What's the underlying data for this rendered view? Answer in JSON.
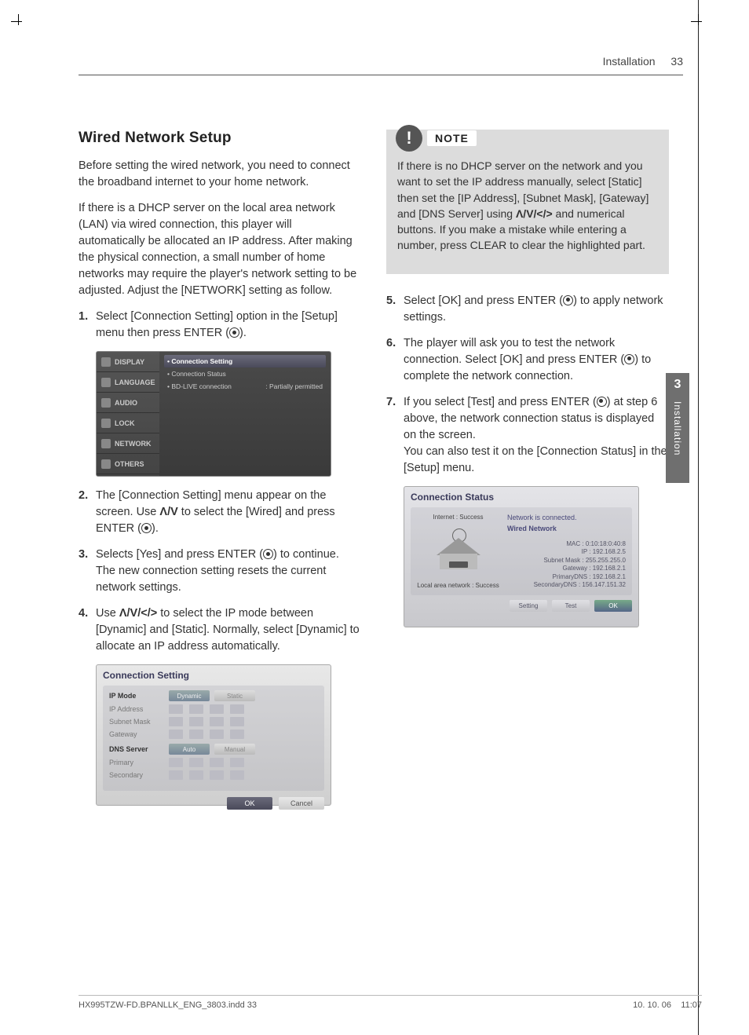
{
  "header": {
    "section": "Installation",
    "page": "33"
  },
  "title": "Wired Network Setup",
  "para1": "Before setting the wired network, you need to connect the broadband internet to your home network.",
  "para2": "If there is a DHCP server on the local area network (LAN) via wired connection, this player will automatically be allocated an IP address. After making the physical connection, a small number of home networks may require the player's network setting to be adjusted. Adjust the [NETWORK] setting as follow.",
  "steps": {
    "s1": "Select [Connection Setting] option in the [Setup] menu then press ENTER (",
    "s1b": ").",
    "s2a": "The [Connection Setting] menu appear on the screen. Use ",
    "s2b": " to select the [Wired] and press ENTER (",
    "s2c": ").",
    "s3a": "Selects [Yes] and press ENTER (",
    "s3b": ") to continue. The new connection setting resets the current network settings.",
    "s4a": "Use ",
    "s4b": " to select the IP mode between [Dynamic] and [Static]. Normally, select [Dynamic] to allocate an IP address automatically.",
    "s5a": "Select [OK] and press ENTER (",
    "s5b": ") to apply network settings.",
    "s6a": "The player will ask you to test the network connection. Select [OK] and press ENTER (",
    "s6b": ") to complete the network connection.",
    "s7a": "If you select [Test] and press ENTER (",
    "s7b": ") at step 6 above, the network connection status is displayed on the screen.",
    "s7c": "You can also test it on the [Connection Status] in the [Setup] menu."
  },
  "arrows_ud": "Λ/V",
  "arrows_all": "Λ/V/</>",
  "note": {
    "title": "NOTE",
    "body_a": "If there is no DHCP server on the network and you want to set the IP address manually, select [Static] then set the [IP Address], [Subnet Mask], [Gateway] and [DNS Server] using ",
    "body_b": " and numerical buttons. If you make a mistake while entering a number, press CLEAR to clear the highlighted part."
  },
  "ss1": {
    "menu": [
      "DISPLAY",
      "LANGUAGE",
      "AUDIO",
      "LOCK",
      "NETWORK",
      "OTHERS"
    ],
    "rows": [
      {
        "label": "• Connection Setting",
        "val": ""
      },
      {
        "label": "• Connection Status",
        "val": ""
      },
      {
        "label": "• BD-LIVE connection",
        "val": ": Partially permitted"
      }
    ]
  },
  "ss2": {
    "title": "Connection Setting",
    "ipmode": "IP Mode",
    "dynamic": "Dynamic",
    "static": "Static",
    "ipaddr": "IP Address",
    "subnet": "Subnet Mask",
    "gateway": "Gateway",
    "dns": "DNS Server",
    "auto": "Auto",
    "manual": "Manual",
    "primary": "Primary",
    "secondary": "Secondary",
    "ok": "OK",
    "cancel": "Cancel"
  },
  "ss3": {
    "title": "Connection Status",
    "internet": "Internet : Success",
    "lan": "Local area network : Success",
    "msg": "Network is connected.",
    "type": "Wired Network",
    "mac": "MAC : 0:10:18:0:40:8",
    "ip": "IP : 192.168.2.5",
    "sm": "Subnet Mask : 255.255.255.0",
    "gw": "Gateway : 192.168.2.1",
    "pd": "PrimaryDNS : 192.168.2.1",
    "sd": "SecondaryDNS : 156.147.151.32",
    "setting": "Setting",
    "test": "Test",
    "ok": "OK"
  },
  "sidetab": {
    "num": "3",
    "label": "Installation"
  },
  "footer": {
    "left": "HX995TZW-FD.BPANLLK_ENG_3803.indd   33",
    "date": "10. 10. 06",
    "time": "11:07"
  }
}
